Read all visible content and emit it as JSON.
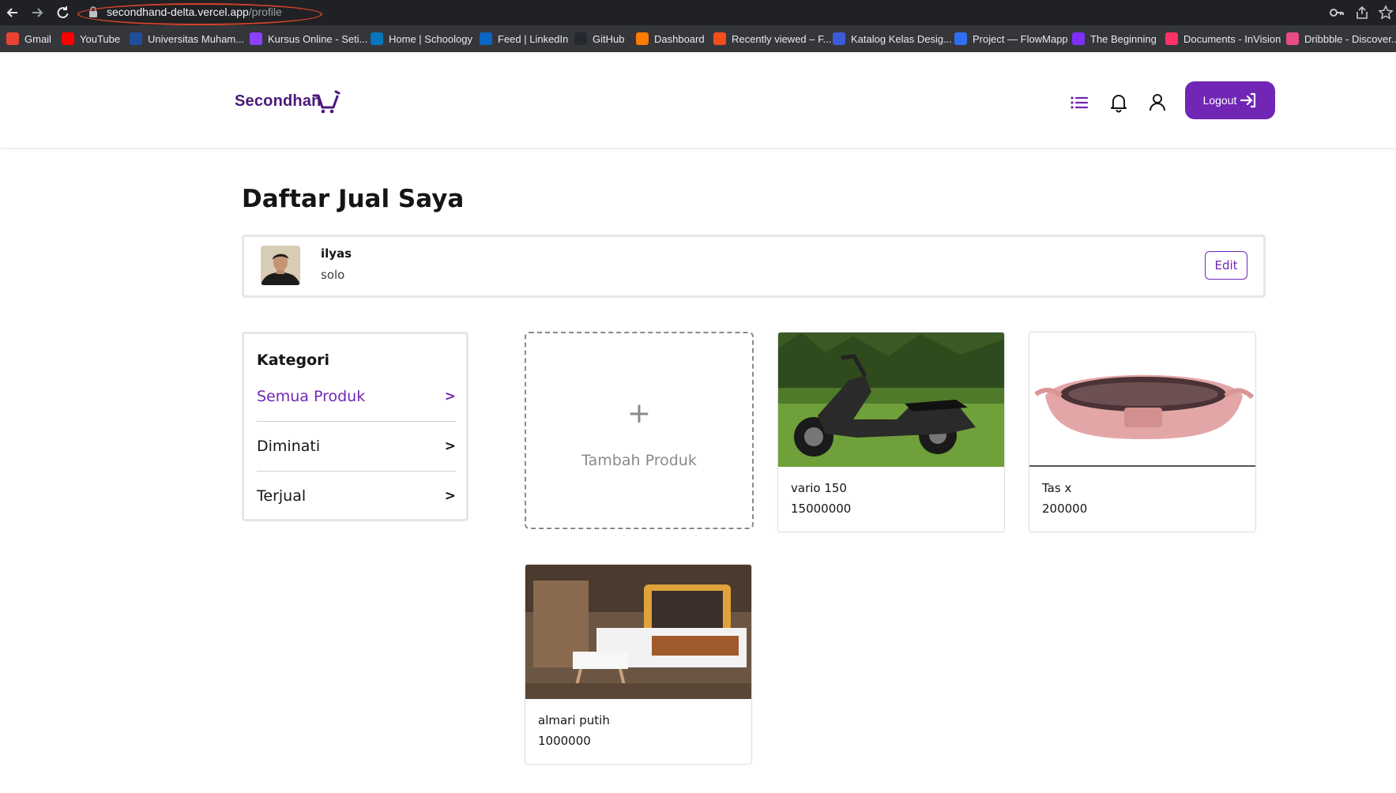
{
  "browser": {
    "url_domain": "secondhand-delta.vercel.app",
    "url_path": "/profile",
    "bookmarks": [
      {
        "label": "Gmail",
        "icon": "gmail-icon",
        "color": "#ea4335"
      },
      {
        "label": "YouTube",
        "icon": "youtube-icon",
        "color": "#ff0000"
      },
      {
        "label": "Universitas Muham...",
        "icon": "university-icon",
        "color": "#1f4e9c"
      },
      {
        "label": "Kursus Online - Seti...",
        "icon": "course-icon",
        "color": "#8a3ffc"
      },
      {
        "label": "Home | Schoology",
        "icon": "schoology-icon",
        "color": "#0677ba"
      },
      {
        "label": "Feed | LinkedIn",
        "icon": "linkedin-icon",
        "color": "#0a66c2"
      },
      {
        "label": "GitHub",
        "icon": "github-icon",
        "color": "#24292f"
      },
      {
        "label": "Dashboard",
        "icon": "dashboard-icon",
        "color": "#ff7a00"
      },
      {
        "label": "Recently viewed – F...",
        "icon": "figma-icon",
        "color": "#f24e1e"
      },
      {
        "label": "Katalog Kelas Desig...",
        "icon": "katalog-icon",
        "color": "#3b5bdb"
      },
      {
        "label": "Project — FlowMapp",
        "icon": "flowmapp-icon",
        "color": "#2f6ff0"
      },
      {
        "label": "The Beginning",
        "icon": "beginning-icon",
        "color": "#7b2ff7"
      },
      {
        "label": "Documents - InVision",
        "icon": "invision-icon",
        "color": "#ff3366"
      },
      {
        "label": "Dribbble - Discover...",
        "icon": "dribbble-icon",
        "color": "#ea4c89"
      }
    ]
  },
  "header": {
    "logo_text": "Secondhan",
    "logout_label": "Logout"
  },
  "page": {
    "title": "Daftar Jual Saya"
  },
  "seller": {
    "name": "ilyas",
    "city": "solo",
    "edit_label": "Edit"
  },
  "categories": {
    "title": "Kategori",
    "items": [
      {
        "label": "Semua Produk",
        "chevron": ">"
      },
      {
        "label": "Diminati",
        "chevron": ">"
      },
      {
        "label": "Terjual",
        "chevron": ">"
      }
    ]
  },
  "add_product": {
    "plus": "+",
    "label": "Tambah Produk"
  },
  "products": [
    {
      "name": "vario 150",
      "price": "15000000"
    },
    {
      "name": "Tas x",
      "price": "200000"
    },
    {
      "name": "almari putih",
      "price": "1000000"
    }
  ],
  "colors": {
    "accent": "#7126b5",
    "logo": "#4b1979",
    "chrome": "#202124",
    "bookmarks_bar": "#35363a",
    "url_highlight": "#d2422a"
  }
}
